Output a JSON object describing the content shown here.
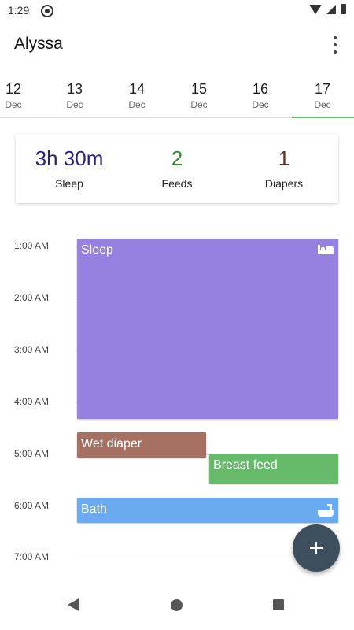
{
  "status_bar": {
    "time": "1:29"
  },
  "app_bar": {
    "title": "Alyssa"
  },
  "date_tabs": [
    {
      "day": "12",
      "month": "Dec",
      "selected": false
    },
    {
      "day": "13",
      "month": "Dec",
      "selected": false
    },
    {
      "day": "14",
      "month": "Dec",
      "selected": false
    },
    {
      "day": "15",
      "month": "Dec",
      "selected": false
    },
    {
      "day": "16",
      "month": "Dec",
      "selected": false
    },
    {
      "day": "17",
      "month": "Dec",
      "selected": true
    }
  ],
  "summary": {
    "sleep": {
      "value": "3h 30m",
      "label": "Sleep",
      "color": "#2e1c8c"
    },
    "feeds": {
      "value": "2",
      "label": "Feeds",
      "color": "#2e8a2e"
    },
    "diapers": {
      "value": "1",
      "label": "Diapers",
      "color": "#5a2e1c"
    }
  },
  "timeline": {
    "hours": [
      "1:00 AM",
      "2:00 AM",
      "3:00 AM",
      "4:00 AM",
      "5:00 AM",
      "6:00 AM",
      "7:00 AM"
    ],
    "events": [
      {
        "title": "Sleep",
        "icon": "bed-icon",
        "color": "#9680e0"
      },
      {
        "title": "Wet diaper",
        "color": "#a67063"
      },
      {
        "title": "Breast feed",
        "color": "#66bb6a"
      },
      {
        "title": "Bath",
        "icon": "bath-icon",
        "color": "#6aaaf0"
      }
    ]
  },
  "accent_color": "#5cb85c",
  "fab": {
    "icon": "add-icon",
    "color": "#3d4f5c"
  }
}
